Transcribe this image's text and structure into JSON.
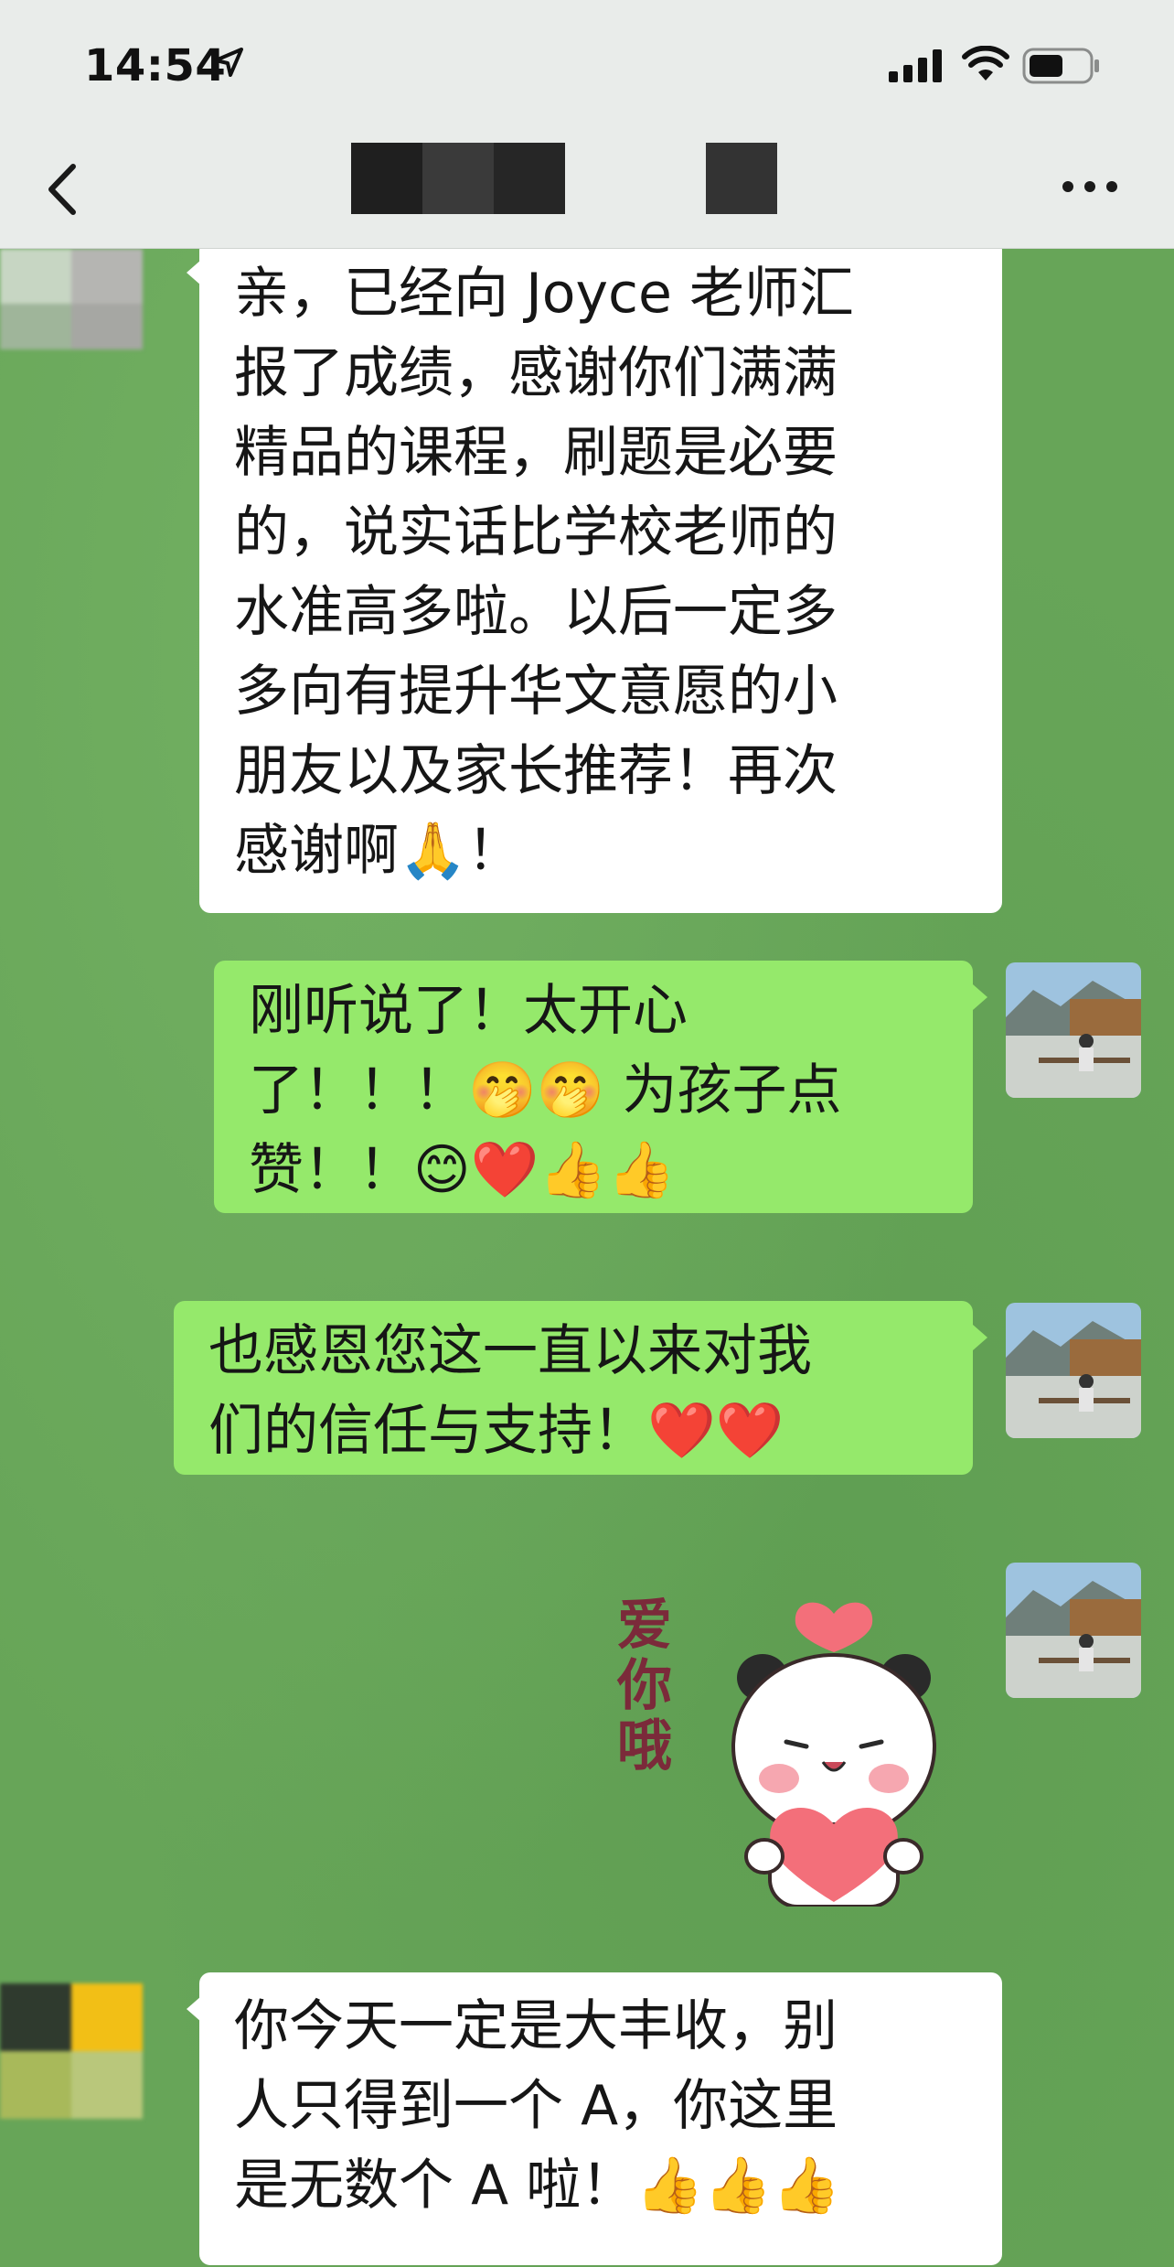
{
  "status_bar": {
    "time": "14:54",
    "icons": [
      "location-arrow-icon",
      "cellular-signal-icon",
      "wifi-icon",
      "battery-icon"
    ]
  },
  "nav": {
    "back_icon": "chevron-left-icon",
    "more_icon": "ellipsis-icon"
  },
  "messages": [
    {
      "side": "left",
      "lines": [
        "亲，已经向 Joyce 老师汇",
        "报了成绩，感谢你们满满",
        "精品的课程，刷题是必要",
        "的，说实话比学校老师的",
        "水准高多啦。以后一定多",
        "多向有提升华文意愿的小",
        "朋友以及家长推荐！再次",
        "感谢啊🙏！"
      ]
    },
    {
      "side": "right",
      "lines": [
        "刚听说了！太开心",
        "了！！！🤭🤭 为孩子点",
        "赞！！😊❤️👍👍"
      ]
    },
    {
      "side": "right",
      "lines": [
        "也感恩您这一直以来对我",
        "们的信任与支持！❤️❤️"
      ]
    },
    {
      "side": "right",
      "type": "sticker",
      "sticker_text": "爱你哦"
    },
    {
      "side": "left",
      "lines": [
        "你今天一定是大丰收，别",
        "人只得到一个 A，你这里",
        "是无数个 A 啦！👍👍👍"
      ]
    }
  ],
  "colors": {
    "chat_background": "#67a558",
    "bubble_sent": "#95e96b",
    "bubble_received": "#ffffff",
    "header_background": "#e9ecea"
  }
}
